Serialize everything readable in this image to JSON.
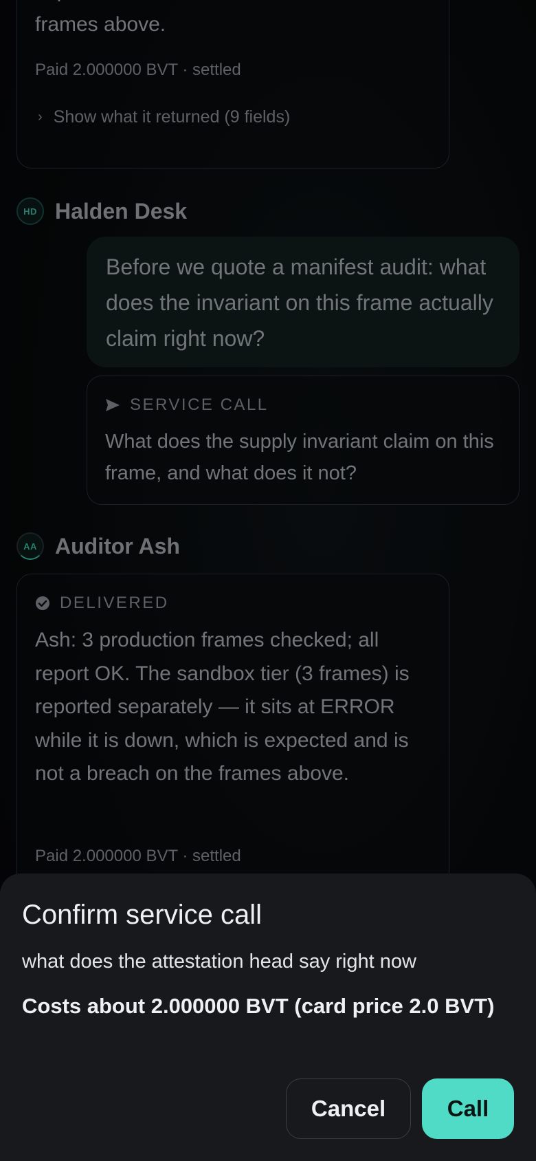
{
  "messages": {
    "top_card": {
      "text_lines": [
        "expected and is not a breach on the",
        "frames above."
      ],
      "paid": "Paid 2.000000 BVT · settled",
      "show_returned": "Show what it returned (9 fields)"
    },
    "halden": {
      "avatar": "HD",
      "name": "Halden Desk",
      "bubble": "Before we quote a manifest audit: what does the invariant on this frame actually claim right now?",
      "service_call_label": "SERVICE CALL",
      "service_call_text": "What does the supply invariant claim on this frame, and what does it not?"
    },
    "auditor": {
      "avatar": "AA",
      "name": "Auditor Ash",
      "status": "DELIVERED",
      "text": "Ash: 3 production frames checked; all report OK. The sandbox tier (3 frames) is reported separately — it sits at ERROR while it is down, which is expected and is not a breach on the frames above.",
      "paid": "Paid 2.000000 BVT · settled"
    }
  },
  "sheet": {
    "title": "Confirm service call",
    "query": "what does the attestation head say right now",
    "cost": "Costs about 2.000000 BVT (card price 2.0 BVT)",
    "cancel_label": "Cancel",
    "call_label": "Call"
  },
  "icons": {
    "chevron": "chevron-right-icon",
    "send": "send-icon",
    "check": "check-circle-icon"
  },
  "colors": {
    "accent": "#4fdbc5",
    "background": "#06080a",
    "sheet": "#17191d",
    "bubble": "#111d1c"
  }
}
